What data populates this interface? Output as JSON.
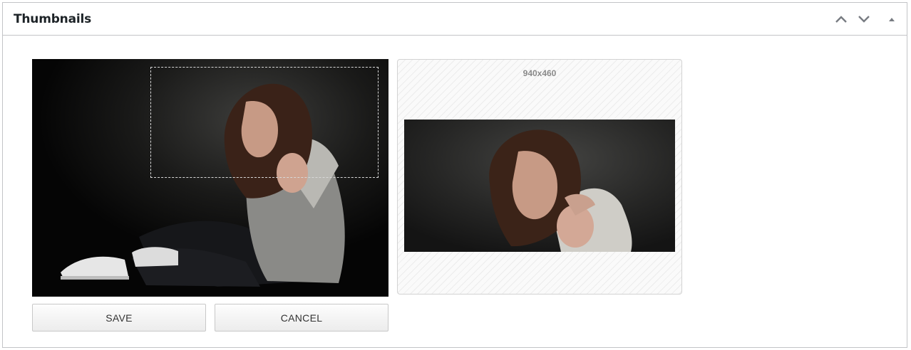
{
  "panel": {
    "title": "Thumbnails",
    "controls": {
      "move_up_icon": "chevron-up-icon",
      "move_down_icon": "chevron-down-icon",
      "toggle_icon": "triangle-up-icon"
    }
  },
  "editor": {
    "save_label": "SAVE",
    "cancel_label": "CANCEL"
  },
  "preview": {
    "size_label": "940x460"
  },
  "colors": {
    "border": "#c3c4c7",
    "header_icon": "#787c82",
    "button_text": "#333333"
  }
}
